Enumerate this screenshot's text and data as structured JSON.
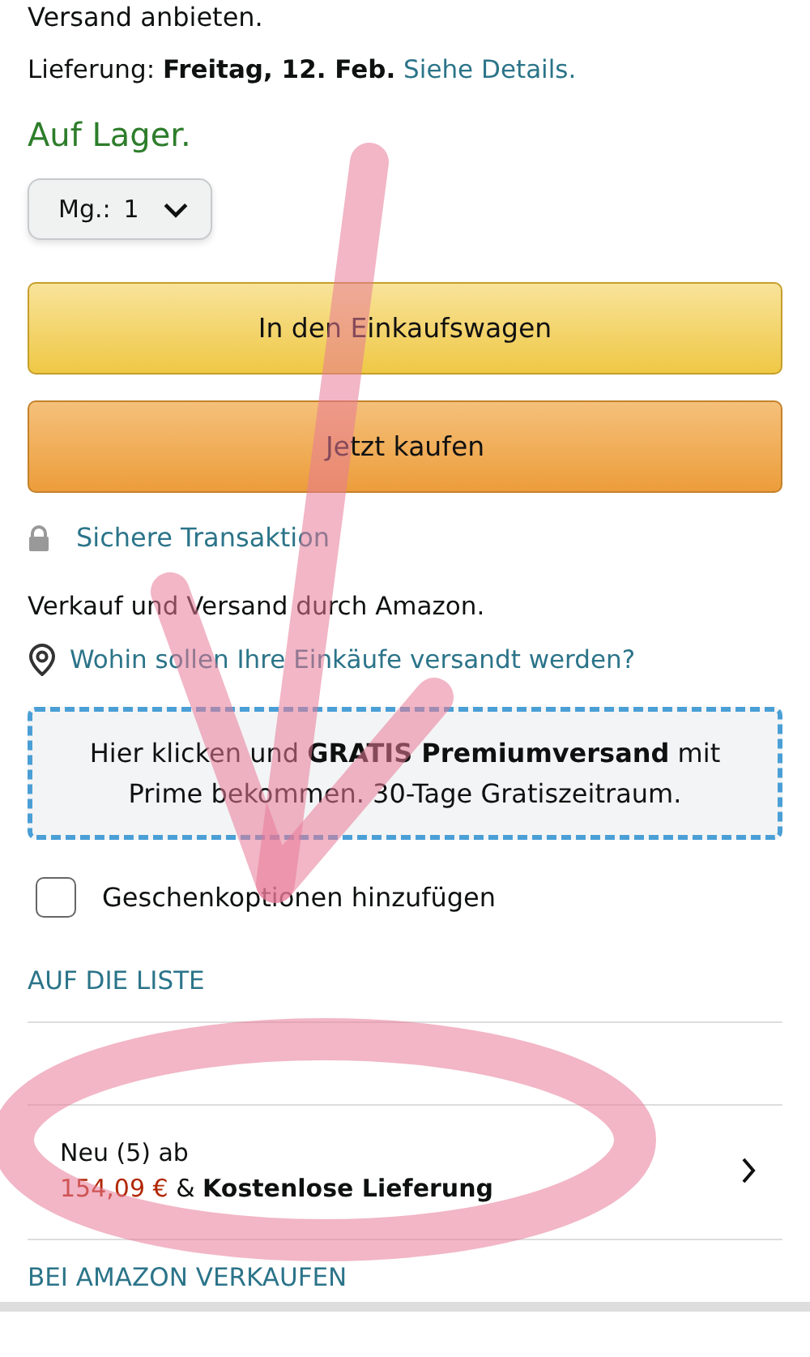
{
  "intro_tail": "Versand anbieten.",
  "delivery": {
    "text": "Lieferung: **Freitag, 12. Feb.**",
    "link": "Siehe Details."
  },
  "stock": "Auf Lager.",
  "quantity": {
    "label": "Mg.:",
    "value": "1"
  },
  "buttons": [
    {
      "label": "In den Einkaufswagen",
      "kind": "cart"
    },
    {
      "label": "Jetzt kaufen",
      "kind": "buy"
    }
  ],
  "secure": "Sichere Transaktion",
  "seller": "Verkauf und Versand durch Amazon.",
  "location_link": "Wohin sollen Ihre Einkäufe versandt werden?",
  "prime_banner": "Hier klicken und **GRATIS Premiumversand** mit Prime bekommen. 30-Tage Gratiszeitraum.",
  "gift": {
    "label": "Geschenkoptionen hinzufügen",
    "checked": false
  },
  "list_link": "AUF DIE LISTE",
  "offers": {
    "title": "Neu (5) ab",
    "price": "154,09 €",
    "rest": "& **Kostenlose Lieferung**"
  },
  "sell_link": "BEI AMAZON VERKAUFEN"
}
